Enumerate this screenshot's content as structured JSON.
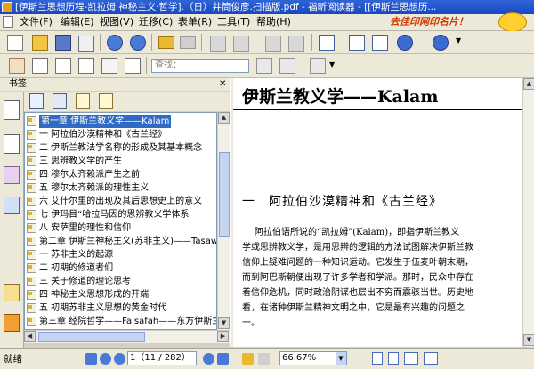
{
  "window": {
    "title": "[伊斯兰思想历程-凯拉姆·神秘主义·哲学].（日）井筒俊彦.扫描版.pdf - 福昕阅读器 - [[伊斯兰思想历..."
  },
  "menu": {
    "items": [
      "文件(F)",
      "编辑(E)",
      "视图(V)",
      "迁移(C)",
      "表单(R)",
      "工具(T)",
      "帮助(H)"
    ],
    "promo": "去佳印网印名片！"
  },
  "toolbar": {
    "find_placeholder": "查找："
  },
  "bookmarks_panel": {
    "title": "书签",
    "close": "✕",
    "items": [
      "第一章 伊斯兰教义学——Kalam",
      "一 阿拉伯沙漠精神和《古兰经》",
      "二 伊斯兰教法学名称的形成及其基本概念",
      "三 思辨教义学的产生",
      "四 穆尔太齐赖派产生之前",
      "五 穆尔太齐赖派的理性主义",
      "六 艾什尔里的出现及其后思想史上的意义",
      "七 伊玛目“哈拉马因的思辨教义学体系",
      "八 安萨里的理性和信仰",
      "第二章 伊斯兰神秘主义(苏非主义)——Tasaw",
      "一 苏非主义的起源",
      "二 初期的修道者们",
      "三 关于修道的理论思考",
      "四 神秘主义思想形成的开端",
      "五 初期苏非主义思想的黄金时代",
      "第三章 经院哲学——Falsafah——东方伊斯兰",
      "一 希腊哲学的传入"
    ],
    "selected_index": 0
  },
  "document": {
    "title": "伊斯兰教义学——Kalam",
    "section_heading": "一　阿拉伯沙漠精神和《古兰经》",
    "paragraph_lines": [
      "阿拉伯语所说的“凯拉姆”(Kalam)，即指伊斯兰教义",
      "学或思辨教义学，是用思辨的逻辑的方法试图解决伊斯兰教",
      "信仰上疑难问题的一种知识运动。它发生于伍麦叶朝末期，",
      "而到阿巴斯朝便出现了许多学者和学派。那时，民众中存在",
      "着信仰危机，同时政治阴谋也层出不穷而震骇当世。历史地",
      "看，在诸种伊斯兰精神文明之中，它是最有兴趣的问题之",
      "一。"
    ]
  },
  "status": {
    "text": "就绪",
    "page_indicator": "1（11 / 282）",
    "zoom": "66.67%"
  },
  "colors": {
    "titlebar": "#1f4fc7",
    "selection": "#316ac5",
    "chrome": "#ece9d8"
  }
}
